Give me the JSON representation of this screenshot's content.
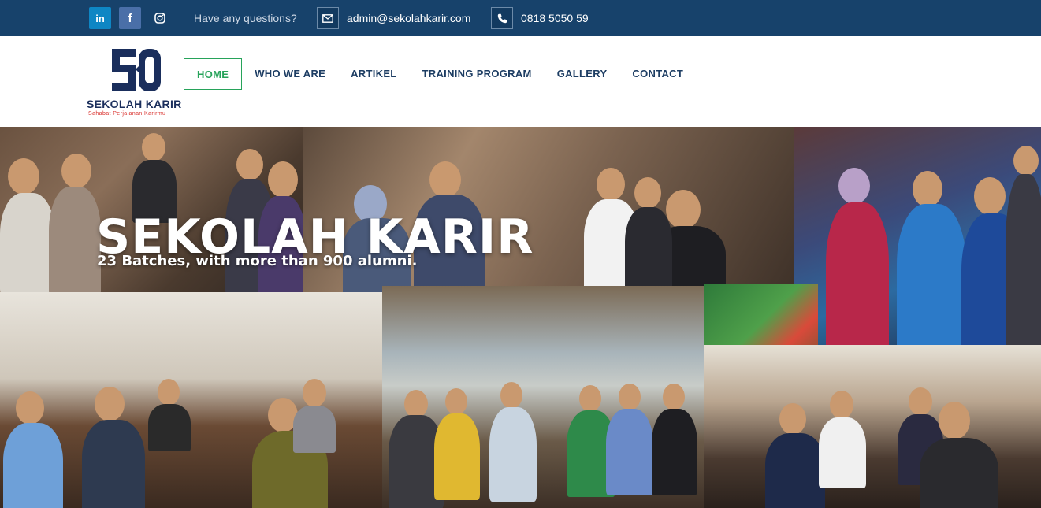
{
  "topbar": {
    "social": [
      {
        "name": "linkedin",
        "glyph": "in"
      },
      {
        "name": "facebook",
        "glyph": "f"
      },
      {
        "name": "instagram",
        "icon": "instagram-icon"
      }
    ],
    "question": "Have any questions?",
    "email": "admin@sekolahkarir.com",
    "phone": "0818 5050 59",
    "colors": {
      "background": "#17426b",
      "linkedin": "#0e86c4",
      "facebook": "#4a6fa8"
    }
  },
  "logo": {
    "title": "SEKOLAH KARIR",
    "tagline": "Sahabat Perjalanan Karirmu",
    "colors": {
      "mark": "#1a2e5c",
      "tagline": "#d9302c"
    }
  },
  "nav": {
    "items": [
      "HOME",
      "WHO WE ARE",
      "ARTIKEL",
      "TRAINING PROGRAM",
      "GALLERY",
      "CONTACT"
    ],
    "active": "HOME",
    "colors": {
      "text": "#1d3d63",
      "active": "#27a35a"
    }
  },
  "hero": {
    "title": "SEKOLAH KARIR",
    "subtitle": "23 Batches, with more than 900 alumni."
  }
}
